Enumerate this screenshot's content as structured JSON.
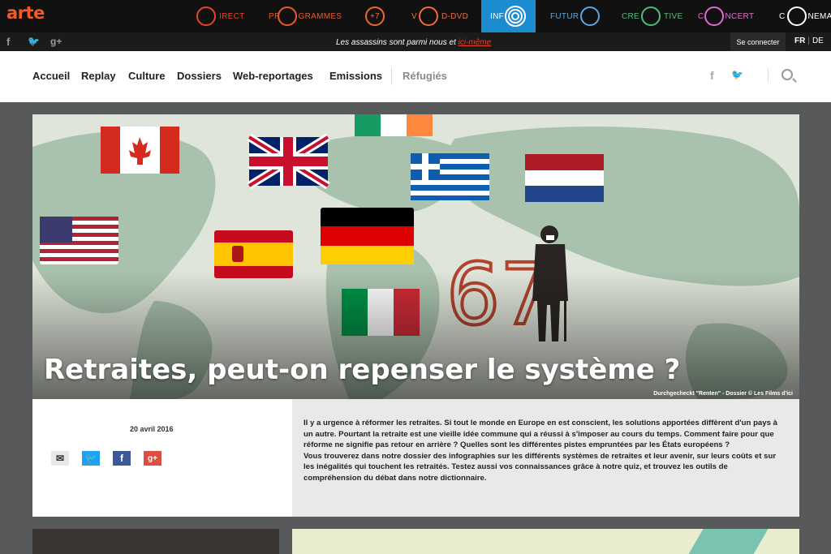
{
  "brand": {
    "logo": "arte"
  },
  "channels": {
    "direct_pre": "",
    "direct_post": "IRECT",
    "prog_pre": "PR",
    "prog_post": "GRAMMES",
    "plus7": "+7",
    "vod_pre": "V",
    "vod_post": "D-DVD",
    "info_pre": "INF",
    "future_pre": "FUTUR",
    "creative_pre": "CRE",
    "creative_post": "TIVE",
    "concert_pre": "C",
    "concert_post": "NCERT",
    "cinema_pre": "C",
    "cinema_post": "NEMA"
  },
  "subbar": {
    "tagline": "Les assassins sont parmi nous et ",
    "tagline_link": "ici-même",
    "login": "Se connecter",
    "lang_fr": "FR",
    "lang_de": "DE"
  },
  "nav": {
    "items": [
      "Accueil",
      "Replay",
      "Culture",
      "Dossiers",
      "Web-reportages",
      "Emissions"
    ],
    "extra": "Réfugiés"
  },
  "hero": {
    "title": "Retraites, peut-on repenser le système ?",
    "credit": "Durchgecheckt \"Renten\" - Dossier © Les Films d'ici",
    "number": "67"
  },
  "article": {
    "date": "20 avril 2016",
    "description_1": "Il y a urgence à réformer les retraites. Si tout le monde en Europe en est conscient, les solutions apportées diffèrent d'un pays à un autre. Pourtant la retraite est une vieille idée commune qui a réussi à s'imposer au cours du temps. Comment faire pour que réforme ne signifie pas retour en arrière ? Quelles sont les différentes pistes empruntées par les États européens ?",
    "description_2": "Vous trouverez dans notre dossier des infographies sur les différents systèmes de retraites et leur avenir, sur leurs coûts et sur les inégalités qui touchent les retraités. Testez aussi vos connaissances grâce à notre quiz, et trouvez les outils de compréhension du débat dans notre dictionnaire."
  },
  "colors": {
    "brand": "#f05a28",
    "info_active": "#1a8ccf",
    "tagline_link": "#e8442a"
  }
}
